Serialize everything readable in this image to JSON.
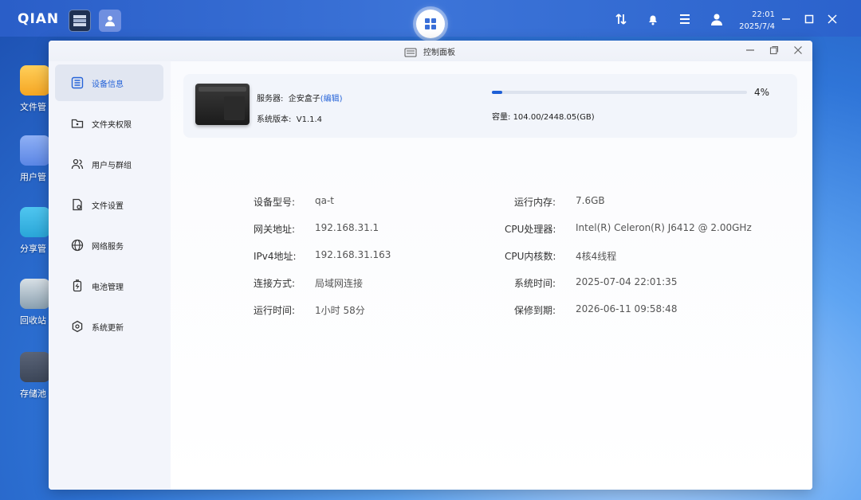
{
  "topbar": {
    "logo": "QIAN",
    "clock_time": "22:01",
    "clock_date": "2025/7/4"
  },
  "desktop": {
    "icons": [
      {
        "label": "文件管",
        "color": "#f5a623"
      },
      {
        "label": "用户管",
        "color": "#5b86e5"
      },
      {
        "label": "分享管",
        "color": "#2aa6d8"
      },
      {
        "label": "回收站",
        "color": "#8aa0b0"
      },
      {
        "label": "存储池",
        "color": "#3c4658"
      }
    ]
  },
  "window": {
    "title": "控制面板"
  },
  "sidebar": {
    "items": [
      {
        "label": "设备信息",
        "icon": "device-info-icon",
        "active": true
      },
      {
        "label": "文件夹权限",
        "icon": "folder-lock-icon",
        "active": false
      },
      {
        "label": "用户与群组",
        "icon": "users-icon",
        "active": false
      },
      {
        "label": "文件设置",
        "icon": "file-settings-icon",
        "active": false
      },
      {
        "label": "网络服务",
        "icon": "globe-icon",
        "active": false
      },
      {
        "label": "电池管理",
        "icon": "battery-icon",
        "active": false
      },
      {
        "label": "系统更新",
        "icon": "update-icon",
        "active": false
      }
    ]
  },
  "server": {
    "name_label": "服务器:",
    "name_value": "企安盒子",
    "edit_label": "(编辑)",
    "version_label": "系统版本:",
    "version_value": "V1.1.4",
    "usage_percent": 4,
    "usage_text": "4%",
    "capacity_label": "容量:",
    "capacity_value": "104.00/2448.05(GB)"
  },
  "details": {
    "left": [
      {
        "label": "设备型号:",
        "value": "qa-t"
      },
      {
        "label": "网关地址:",
        "value": "192.168.31.1"
      },
      {
        "label": "IPv4地址:",
        "value": "192.168.31.163"
      },
      {
        "label": "连接方式:",
        "value": "局域网连接"
      },
      {
        "label": "运行时间:",
        "value": "1小时 58分"
      }
    ],
    "right": [
      {
        "label": "运行内存:",
        "value": "7.6GB"
      },
      {
        "label": "CPU处理器:",
        "value": "Intel(R) Celeron(R) J6412 @ 2.00GHz"
      },
      {
        "label": "CPU内核数:",
        "value": "4核4线程"
      },
      {
        "label": "系统时间:",
        "value": "2025-07-04 22:01:35"
      },
      {
        "label": "保修到期:",
        "value": "2026-06-11 09:58:48"
      }
    ]
  },
  "colors": {
    "accent": "#2563d8",
    "progress": "#1e5fd6"
  }
}
